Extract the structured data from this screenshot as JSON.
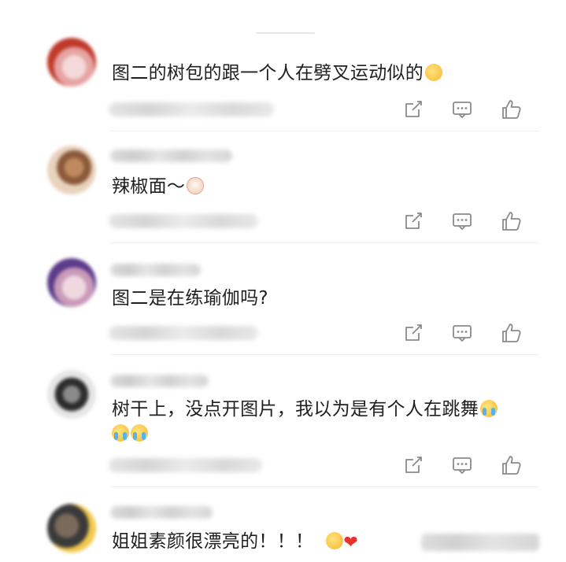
{
  "comments": [
    {
      "text": "图二的树包的跟一个人在劈叉运动似的",
      "emoji": "laughing-crying-emoji",
      "avatar_colors": [
        "#c0392b",
        "#e8a0a0",
        "#f2d6d6"
      ]
    },
    {
      "text": "辣椒面～",
      "emoji": "bun-emoji",
      "avatar_colors": [
        "#8a5a3a",
        "#c08a60",
        "#e9d2bd"
      ]
    },
    {
      "text": "图二是在练瑜伽吗?",
      "emoji": "",
      "avatar_colors": [
        "#5b3b8a",
        "#c89ab8",
        "#f0d8e0"
      ]
    },
    {
      "text": "树干上，没点开图片，我以为是有个人在跳舞",
      "emoji": "crying-emoji",
      "avatar_colors": [
        "#2c2c2c",
        "#8a8a8a",
        "#e6e6e6"
      ]
    },
    {
      "text": "姐姐素颜很漂亮的！！！",
      "emoji": "laughing-crying-emoji heart-emoji",
      "avatar_colors": [
        "#3a3a3a",
        "#7a6a5a",
        "#f2c94c"
      ]
    }
  ],
  "actions": [
    "share-icon",
    "comment-icon",
    "like-icon"
  ]
}
